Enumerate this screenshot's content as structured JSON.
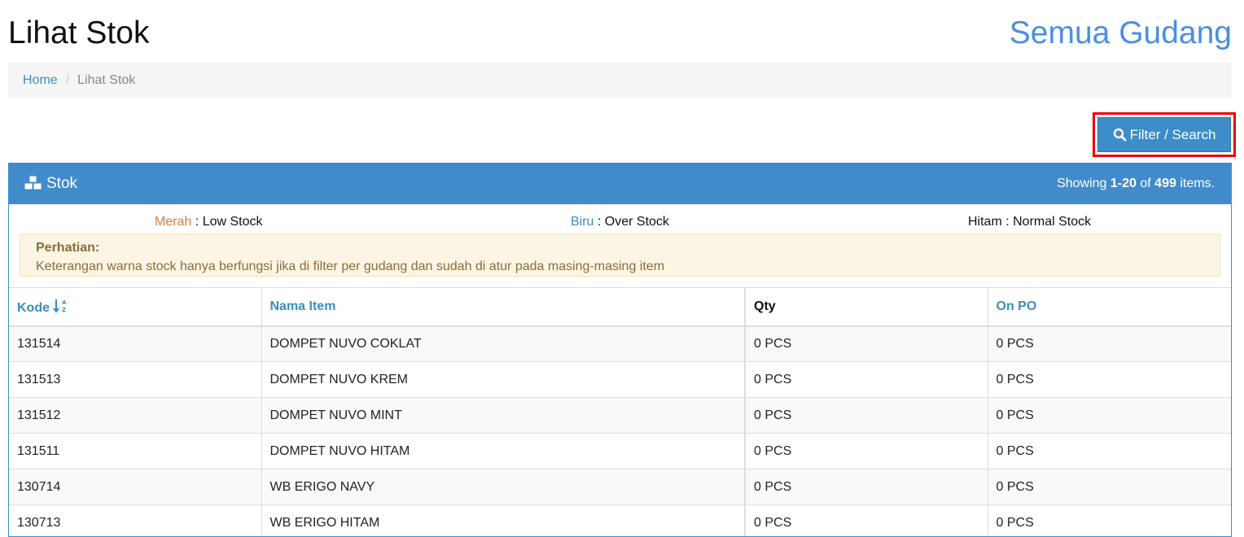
{
  "header": {
    "title": "Lihat Stok",
    "warehouse": "Semua Gudang"
  },
  "breadcrumb": {
    "home": "Home",
    "separator": "/",
    "current": "Lihat Stok"
  },
  "toolbar": {
    "filter_label": "Filter / Search",
    "filter_icon": "search-icon"
  },
  "panel": {
    "title": "Stok",
    "title_icon": "cubes-icon",
    "summary_prefix": "Showing ",
    "summary_range": "1-20",
    "summary_mid": " of ",
    "summary_total": "499",
    "summary_suffix": " items."
  },
  "legend": {
    "red_label": "Merah",
    "red_text": " : Low Stock",
    "blue_label": "Biru",
    "blue_text": " : Over Stock",
    "black_label": "Hitam",
    "black_text": " : Normal Stock"
  },
  "alert": {
    "title": "Perhatian:",
    "message": "Keterangan warna stock hanya berfungsi jika di filter per gudang dan sudah di atur pada masing-masing item"
  },
  "table": {
    "columns": {
      "kode": "Kode",
      "nama": "Nama Item",
      "qty": "Qty",
      "onpo": "On PO"
    },
    "rows": [
      {
        "kode": "131514",
        "nama": "DOMPET NUVO COKLAT",
        "qty": "0 PCS",
        "onpo": "0 PCS"
      },
      {
        "kode": "131513",
        "nama": "DOMPET NUVO KREM",
        "qty": "0 PCS",
        "onpo": "0 PCS"
      },
      {
        "kode": "131512",
        "nama": "DOMPET NUVO MINT",
        "qty": "0 PCS",
        "onpo": "0 PCS"
      },
      {
        "kode": "131511",
        "nama": "DOMPET NUVO HITAM",
        "qty": "0 PCS",
        "onpo": "0 PCS"
      },
      {
        "kode": "130714",
        "nama": "WB ERIGO NAVY",
        "qty": "0 PCS",
        "onpo": "0 PCS"
      },
      {
        "kode": "130713",
        "nama": "WB ERIGO HITAM",
        "qty": "0 PCS",
        "onpo": "0 PCS"
      }
    ]
  },
  "colors": {
    "accent": "#428bca",
    "link": "#3c8dbc",
    "warehouse_title": "#4a8fe0",
    "low_stock": "#e07b39",
    "highlight_border": "#ee0000"
  }
}
